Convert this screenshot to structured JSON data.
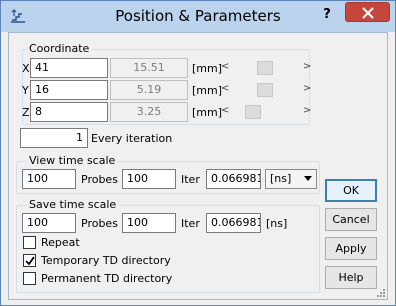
{
  "window": {
    "title": "Position & Parameters",
    "help_glyph": "?"
  },
  "coordinate": {
    "group_label": "Coordinate",
    "unit": "[mm]",
    "rows": [
      {
        "axis": "X",
        "value": "41",
        "readout": "15.51",
        "slider_level": 0.55
      },
      {
        "axis": "Y",
        "value": "16",
        "readout": "5.19",
        "slider_level": 0.55
      },
      {
        "axis": "Z",
        "value": "8",
        "readout": "3.25",
        "slider_level": 0.33
      }
    ]
  },
  "iteration": {
    "value": "1",
    "label": "Every iteration"
  },
  "view_time_scale": {
    "group_label": "View time scale",
    "value": "100",
    "probes_label": "Probes",
    "probes_value": "100",
    "iter_label": "Iter",
    "iter_value": "0.066981",
    "unit_selected": "[ns]"
  },
  "save_time_scale": {
    "group_label": "Save time scale",
    "value": "100",
    "probes_label": "Probes",
    "probes_value": "100",
    "iter_label": "Iter",
    "iter_value": "0.066981",
    "unit": "[ns]",
    "options": [
      {
        "label": "Repeat",
        "checked": false
      },
      {
        "label": "Temporary TD directory",
        "checked": true
      },
      {
        "label": "Permanent TD directory",
        "checked": false
      }
    ]
  },
  "buttons": {
    "ok": "OK",
    "cancel": "Cancel",
    "apply": "Apply",
    "help": "Help"
  },
  "icons": {
    "app": "stairs-app-icon",
    "close": "close-icon",
    "dropdown": "chevron-down-icon",
    "check": "checkmark-icon"
  },
  "colors": {
    "titlebar": "#bcd3ee",
    "close_button": "#c7463b",
    "default_button_border": "#3c7fb1"
  }
}
